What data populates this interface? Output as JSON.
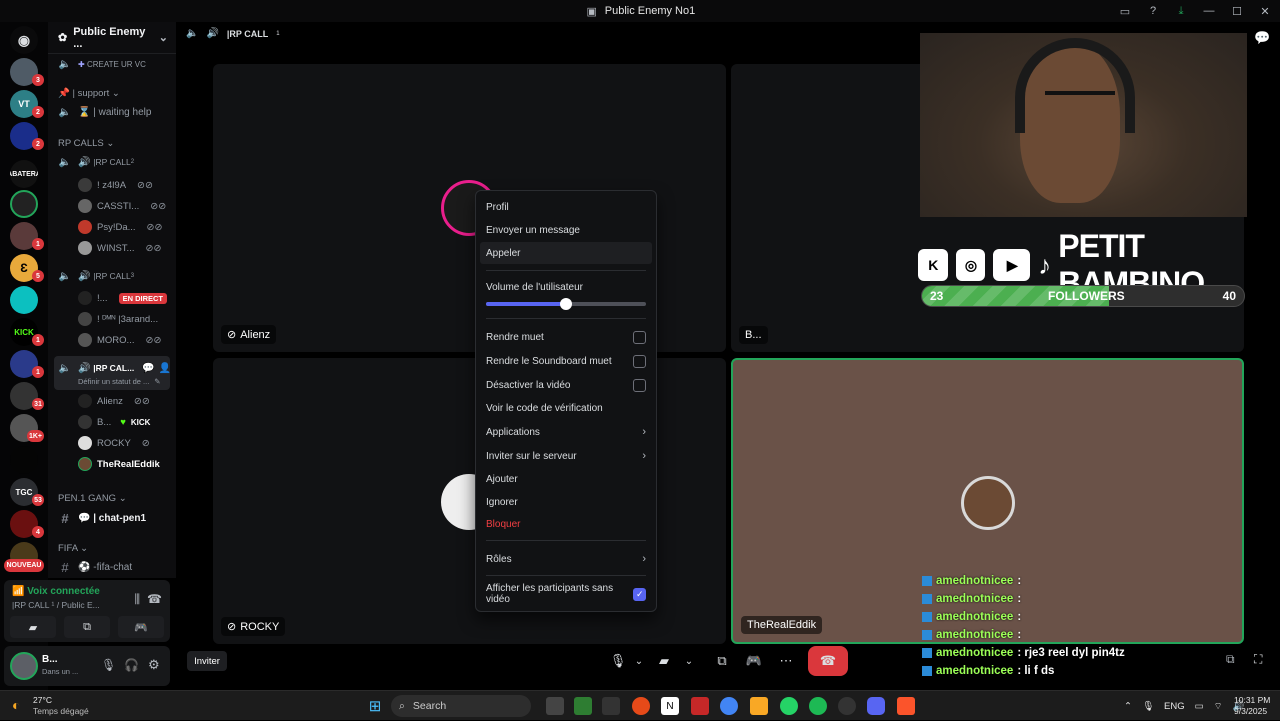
{
  "window": {
    "title": "Public Enemy No1"
  },
  "server": {
    "name": "Public Enemy ..."
  },
  "channels": {
    "create_vc": "CREATE UR VC",
    "support_category": "| support",
    "waiting_help": "| waiting help",
    "rp_calls_category": "RP CALLS",
    "rp_call_1": "|RP CALL",
    "rp_call_1_sup": "2",
    "rp_call_1_members": [
      "! z4l9A",
      "CASSTI...",
      "Psy!Da...",
      "WINST..."
    ],
    "rp_call_2": "|RP CALL",
    "rp_call_2_sup": "3",
    "rp_call_2_members": [
      "!...",
      "! ᴰᴹᴺ |3arand...",
      "MORO..."
    ],
    "live_badge": "EN DIRECT",
    "rp_call_3": "|RP CAL...",
    "rp_call_3_status": "Définir un statut de ...",
    "rp_call_3_members": [
      "Alienz",
      "B...",
      "ROCKY",
      "TheRealEddik"
    ],
    "kick_label": "KICK",
    "pen_category": "PEN.1 GANG",
    "chat_pen": "| chat-pen1",
    "fifa_category": "FIFA",
    "fifa_chat": "-fifa-chat"
  },
  "guild_badges": [
    "3",
    "2",
    "2",
    "1",
    "5",
    "1",
    "1",
    "31",
    "1K+",
    "53",
    "4"
  ],
  "nouveau": "NOUVEAU",
  "voice": {
    "status": "Voix connectée",
    "channel": "|RP CALL ¹ / Public E..."
  },
  "user": {
    "name": "B...",
    "status": "Dans un ..."
  },
  "stage": {
    "header_channel": "|RP CALL",
    "header_sup": "1",
    "tiles": [
      "Alienz",
      "B...",
      "ROCKY",
      "TheRealEddik"
    ]
  },
  "overlay": {
    "brand": "PETIT BAMBINO",
    "followers_label": "FOLLOWERS",
    "followers_min": "23",
    "followers_max": "40",
    "followers_progress": 0.58
  },
  "menu": {
    "profil": "Profil",
    "message": "Envoyer un message",
    "appeler": "Appeler",
    "volume_label": "Volume de l'utilisateur",
    "volume_value": 0.5,
    "mute": "Rendre muet",
    "soundboard_mute": "Rendre le Soundboard muet",
    "disable_video": "Désactiver la vidéo",
    "verify_code": "Voir le code de vérification",
    "applications": "Applications",
    "invite_server": "Inviter sur le serveur",
    "ajouter": "Ajouter",
    "ignorer": "Ignorer",
    "bloquer": "Bloquer",
    "roles": "Rôles",
    "show_no_video": "Afficher les participants sans vidéo"
  },
  "chat": [
    {
      "user": "amednotnicee",
      "msg": ":"
    },
    {
      "user": "amednotnicee",
      "msg": ":"
    },
    {
      "user": "amednotnicee",
      "msg": ":"
    },
    {
      "user": "amednotnicee",
      "msg": ":"
    },
    {
      "user": "amednotnicee",
      "msg": ": rje3 reel dyl pin4tz"
    },
    {
      "user": "amednotnicee",
      "msg": ": li f ds"
    }
  ],
  "invite_button": "Inviter",
  "taskbar": {
    "weather_temp": "27°C",
    "weather_desc": "Temps dégagé",
    "search": "Search",
    "lang": "ENG",
    "time": "10:31 PM",
    "date": "9/3/2025"
  },
  "colors": {
    "accent": "#5865f2",
    "danger": "#f23f43",
    "online": "#23a55a",
    "live": "#da373c"
  }
}
